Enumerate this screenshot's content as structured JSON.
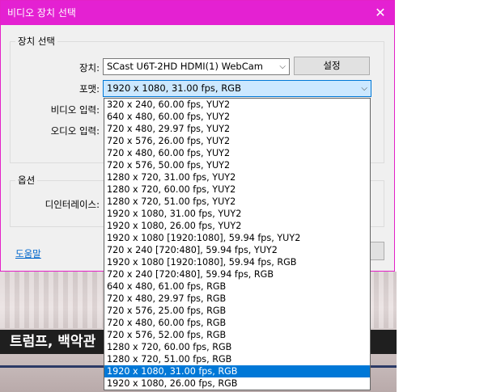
{
  "dialog": {
    "title": "비디오 장치 선택",
    "group_device": "장치 선택",
    "label_device": "장치:",
    "device_value": "SCast U6T-2HD HDMI(1) WebCam",
    "settings_button": "설정",
    "label_format": "포맷:",
    "format_value": "1920 x 1080, 31.00 fps, RGB",
    "label_video_input": "비디오 입력:",
    "label_audio_input": "오디오 입력:",
    "group_options": "옵션",
    "label_deinterlace": "디인터레이스:",
    "help_link": "도움말"
  },
  "dropdown": {
    "items": [
      "320 x 240, 60.00 fps, YUY2",
      "640 x 480, 60.00 fps, YUY2",
      "720 x 480, 29.97 fps, YUY2",
      "720 x 576, 26.00 fps, YUY2",
      "720 x 480, 60.00 fps, YUY2",
      "720 x 576, 50.00 fps, YUY2",
      "1280 x 720, 31.00 fps, YUY2",
      "1280 x 720, 60.00 fps, YUY2",
      "1280 x 720, 51.00 fps, YUY2",
      "1920 x 1080, 31.00 fps, YUY2",
      "1920 x 1080, 26.00 fps, YUY2",
      "1920 x 1080 [1920:1080], 59.94 fps, YUY2",
      "720 x 240 [720:480], 59.94 fps, YUY2",
      "1920 x 1080 [1920:1080], 59.94 fps, RGB",
      "720 x 240 [720:480], 59.94 fps, RGB",
      "640 x 480, 61.00 fps, RGB",
      "720 x 480, 29.97 fps, RGB",
      "720 x 576, 25.00 fps, RGB",
      "720 x 480, 60.00 fps, RGB",
      "720 x 576, 52.00 fps, RGB",
      "1280 x 720, 60.00 fps, RGB",
      "1280 x 720, 51.00 fps, RGB",
      "1920 x 1080, 31.00 fps, RGB",
      "1920 x 1080, 26.00 fps, RGB"
    ],
    "selected_index": 22
  },
  "background": {
    "caption": "트럼프, 백악관"
  }
}
